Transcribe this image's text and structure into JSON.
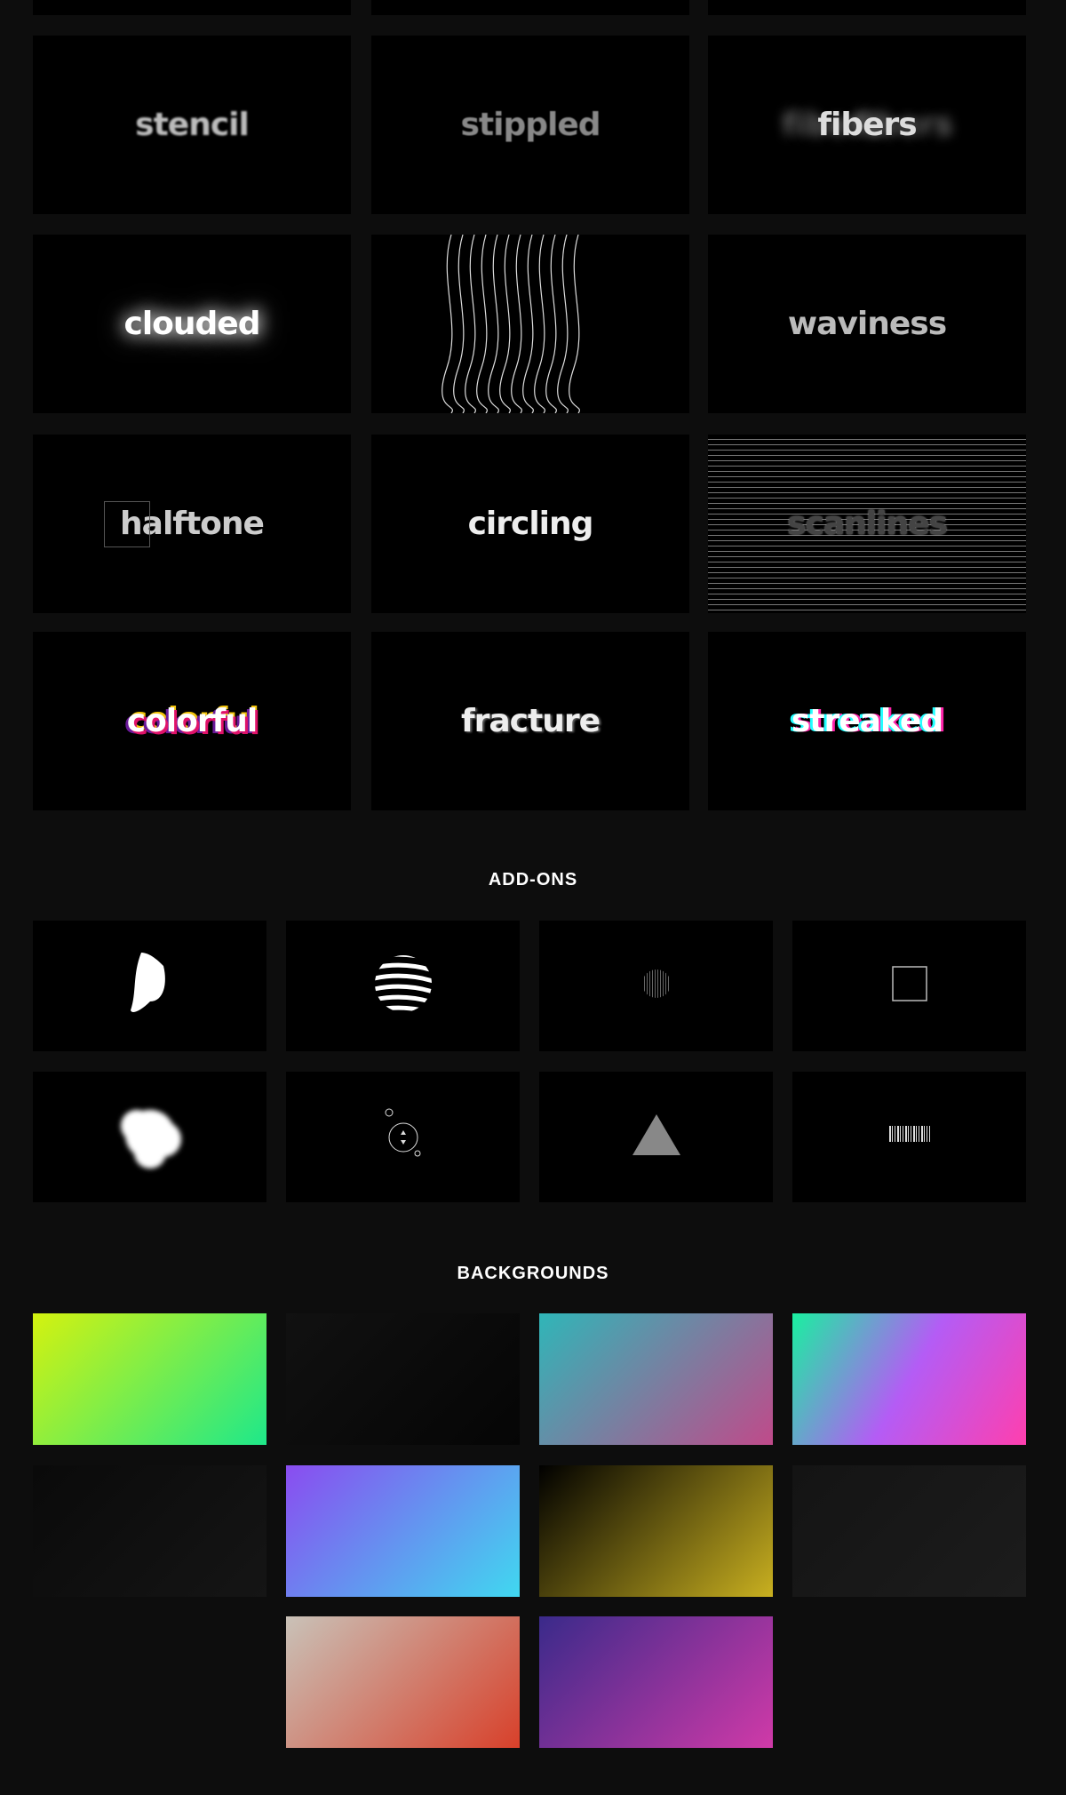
{
  "effects": [
    {
      "label": "stencil"
    },
    {
      "label": "stippled"
    },
    {
      "label": "fibers"
    },
    {
      "label": "clouded"
    },
    {
      "label": ""
    },
    {
      "label": "waviness"
    },
    {
      "label": "halftone"
    },
    {
      "label": "circling"
    },
    {
      "label": "scanlines"
    },
    {
      "label": "colorful"
    },
    {
      "label": "fracture"
    },
    {
      "label": "streaked"
    }
  ],
  "addons": {
    "heading": "ADD-ONS",
    "items": [
      "blob",
      "striped-sphere",
      "dotted-sphere",
      "square-outline",
      "cloud",
      "circle-target",
      "triangle",
      "barcode"
    ]
  },
  "backgrounds": {
    "heading": "BACKGROUNDS",
    "items": [
      {
        "name": "yellow-green-gradient",
        "colors": [
          "#d4f20f",
          "#1ee88a"
        ]
      },
      {
        "name": "dark-texture",
        "colors": [
          "#111111",
          "#050505"
        ]
      },
      {
        "name": "teal-people-photo",
        "colors": [
          "#2fb6b8",
          "#c04a8a"
        ]
      },
      {
        "name": "green-purple-pink-gradient",
        "colors": [
          "#19f0a0",
          "#b45cf5",
          "#ff3fae"
        ]
      },
      {
        "name": "dark-waves",
        "colors": [
          "#0a0a0a",
          "#151515"
        ]
      },
      {
        "name": "mirrored-blue-photo",
        "colors": [
          "#8a4cf0",
          "#40d8f0"
        ]
      },
      {
        "name": "yellow-dot-waves",
        "colors": [
          "#000000",
          "#c9b020"
        ]
      },
      {
        "name": "dark-grunge",
        "colors": [
          "#141414",
          "#1c1c1c"
        ]
      },
      {
        "name": "people-room-photo",
        "colors": [
          "#c9c2b8",
          "#d8402a"
        ]
      },
      {
        "name": "purple-neon-photo",
        "colors": [
          "#3a2a8a",
          "#d03aa8"
        ]
      }
    ]
  }
}
